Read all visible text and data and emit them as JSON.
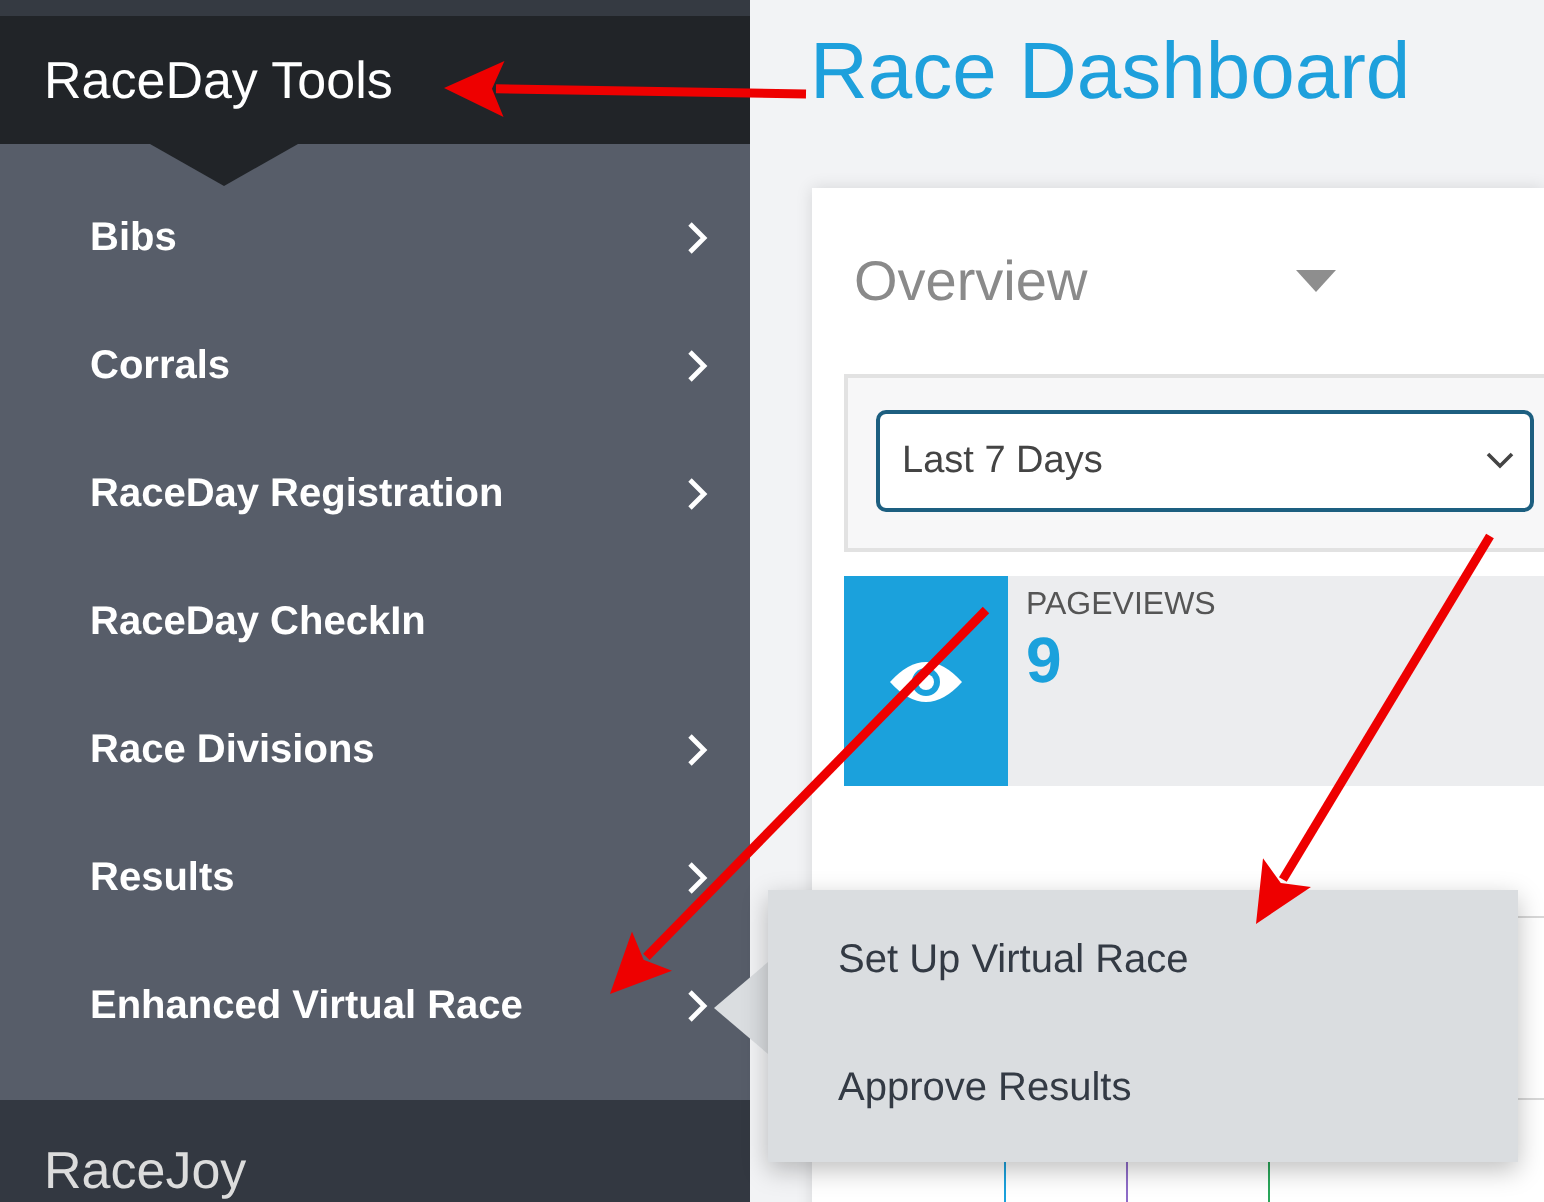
{
  "sidebar": {
    "sections": [
      {
        "title": "RaceDay Tools",
        "expanded": true,
        "items": [
          {
            "label": "Bibs",
            "has_submenu": true,
            "expanded": false
          },
          {
            "label": "Corrals",
            "has_submenu": true,
            "expanded": false
          },
          {
            "label": "RaceDay Registration",
            "has_submenu": true,
            "expanded": false
          },
          {
            "label": "RaceDay CheckIn",
            "has_submenu": false,
            "expanded": false
          },
          {
            "label": "Race Divisions",
            "has_submenu": true,
            "expanded": false
          },
          {
            "label": "Results",
            "has_submenu": true,
            "expanded": false
          },
          {
            "label": "Enhanced Virtual Race",
            "has_submenu": true,
            "expanded": true,
            "submenu": [
              "Set Up Virtual Race",
              "Approve Results"
            ]
          }
        ]
      },
      {
        "title": "RaceJoy",
        "expanded": false
      }
    ]
  },
  "main": {
    "title": "Race Dashboard",
    "card": {
      "title": "Overview",
      "date_range": "Last 7 Days",
      "stats": [
        {
          "label": "PAGEVIEWS",
          "value": "9"
        }
      ]
    }
  }
}
